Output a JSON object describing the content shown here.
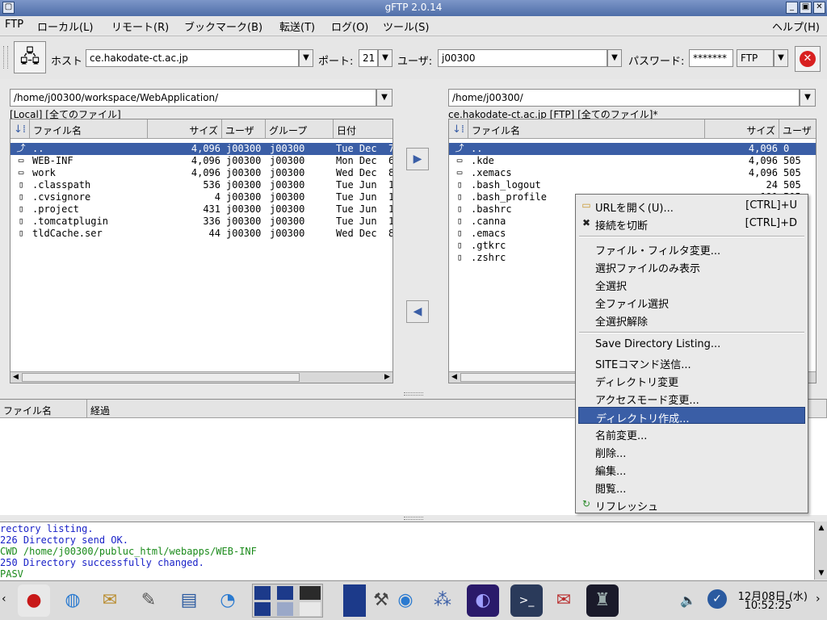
{
  "window": {
    "title": "gFTP 2.0.14"
  },
  "menubar": [
    "FTP",
    "ローカル(L)",
    "リモート(R)",
    "ブックマーク(B)",
    "転送(T)",
    "ログ(O)",
    "ツール(S)",
    "ヘルプ(H)"
  ],
  "toolbar": {
    "host_label": "ホスト",
    "host_value": "ce.hakodate-ct.ac.jp",
    "port_label": "ポート:",
    "port_value": "21",
    "user_label": "ユーザ:",
    "user_value": "j00300",
    "password_label": "パスワード:",
    "password_value": "*******",
    "protocol": "FTP"
  },
  "local": {
    "path": "/home/j00300/workspace/WebApplication/",
    "status": "[Local] [全てのファイル]",
    "columns": [
      "ファイル名",
      "サイズ",
      "ユーザ",
      "グループ",
      "日付"
    ],
    "files": [
      {
        "name": "..",
        "size": "4,096",
        "user": "j00300",
        "group": "j00300",
        "date": "Tue Dec  7",
        "icon": "up-dir-icon"
      },
      {
        "name": "WEB-INF",
        "size": "4,096",
        "user": "j00300",
        "group": "j00300",
        "date": "Mon Dec  6",
        "icon": "folder-icon"
      },
      {
        "name": "work",
        "size": "4,096",
        "user": "j00300",
        "group": "j00300",
        "date": "Wed Dec  8",
        "icon": "folder-icon"
      },
      {
        "name": ".classpath",
        "size": "536",
        "user": "j00300",
        "group": "j00300",
        "date": "Tue Jun  1",
        "icon": "file-icon"
      },
      {
        "name": ".cvsignore",
        "size": "4",
        "user": "j00300",
        "group": "j00300",
        "date": "Tue Jun  1",
        "icon": "file-icon"
      },
      {
        "name": ".project",
        "size": "431",
        "user": "j00300",
        "group": "j00300",
        "date": "Tue Jun  1",
        "icon": "file-icon"
      },
      {
        "name": ".tomcatplugin",
        "size": "336",
        "user": "j00300",
        "group": "j00300",
        "date": "Tue Jun  1",
        "icon": "file-icon"
      },
      {
        "name": "tldCache.ser",
        "size": "44",
        "user": "j00300",
        "group": "j00300",
        "date": "Wed Dec  8",
        "icon": "file-icon"
      }
    ]
  },
  "remote": {
    "path": "/home/j00300/",
    "status": "ce.hakodate-ct.ac.jp [FTP] [全てのファイル]*",
    "columns": [
      "ファイル名",
      "サイズ",
      "ユーザ"
    ],
    "files": [
      {
        "name": "..",
        "size": "4,096",
        "user": "0",
        "icon": "up-dir-icon"
      },
      {
        "name": ".kde",
        "size": "4,096",
        "user": "505",
        "icon": "folder-icon"
      },
      {
        "name": ".xemacs",
        "size": "4,096",
        "user": "505",
        "icon": "folder-icon"
      },
      {
        "name": ".bash_logout",
        "size": "24",
        "user": "505",
        "icon": "file-icon"
      },
      {
        "name": ".bash_profile",
        "size": "191",
        "user": "505",
        "icon": "file-icon"
      },
      {
        "name": ".bashrc",
        "size": "",
        "user": "",
        "icon": "file-icon"
      },
      {
        "name": ".canna",
        "size": "",
        "user": "",
        "icon": "file-icon"
      },
      {
        "name": ".emacs",
        "size": "",
        "user": "",
        "icon": "file-icon"
      },
      {
        "name": ".gtkrc",
        "size": "",
        "user": "",
        "icon": "file-icon"
      },
      {
        "name": ".zshrc",
        "size": "",
        "user": "",
        "icon": "file-icon"
      }
    ]
  },
  "transfer": {
    "columns": [
      "ファイル名",
      "経過"
    ]
  },
  "log": [
    {
      "text": "rectory listing.",
      "color": "#1a22c8"
    },
    {
      "text": "226 Directory send OK.",
      "color": "#1a22c8"
    },
    {
      "text": "CWD /home/j00300/publuc_html/webapps/WEB-INF",
      "color": "#1a8a1a"
    },
    {
      "text": "250 Directory successfully changed.",
      "color": "#1a22c8"
    },
    {
      "text": "PASV",
      "color": "#1a8a1a"
    }
  ],
  "context_menu": [
    {
      "label": "URLを開く(U)...",
      "shortcut": "[CTRL]+U",
      "icon": "folder-open-icon"
    },
    {
      "label": "接続を切断",
      "shortcut": "[CTRL]+D",
      "icon": "disconnect-icon"
    },
    {
      "sep": true
    },
    {
      "label": "ファイル・フィルタ変更..."
    },
    {
      "label": "選択ファイルのみ表示"
    },
    {
      "label": "全選択"
    },
    {
      "label": "全ファイル選択"
    },
    {
      "label": "全選択解除"
    },
    {
      "sep": true
    },
    {
      "label": "Save Directory Listing..."
    },
    {
      "label": "SITEコマンド送信..."
    },
    {
      "label": "ディレクトリ変更"
    },
    {
      "label": "アクセスモード変更..."
    },
    {
      "label": "ディレクトリ作成...",
      "highlighted": true
    },
    {
      "label": "名前変更..."
    },
    {
      "label": "削除..."
    },
    {
      "label": "編集..."
    },
    {
      "label": "閲覧..."
    },
    {
      "label": "リフレッシュ",
      "icon": "refresh-icon"
    }
  ],
  "taskbar": {
    "date": "12月08日 (水)",
    "time": "10:52:25"
  }
}
